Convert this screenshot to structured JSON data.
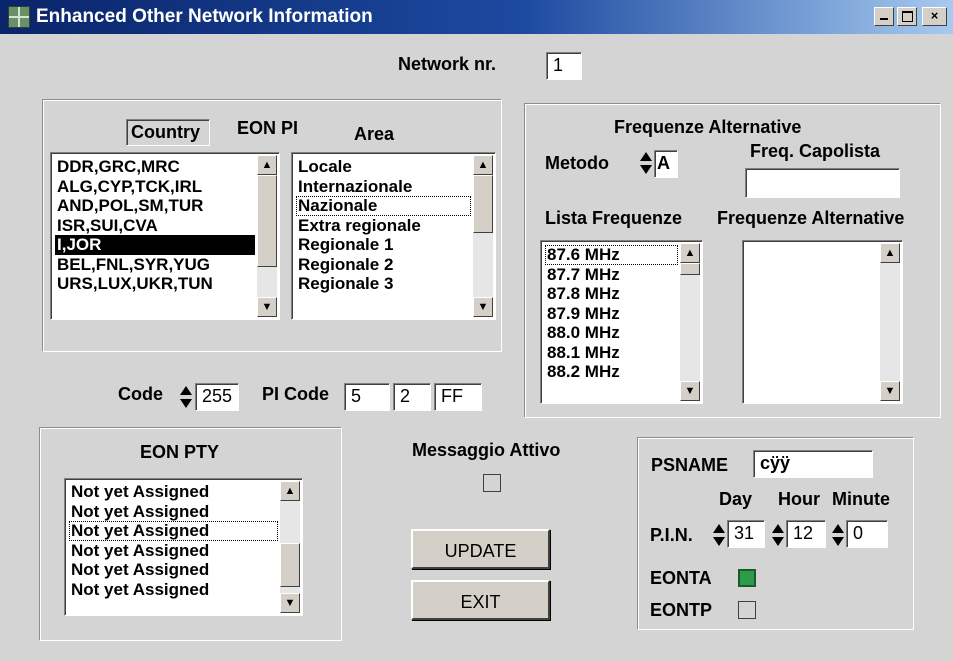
{
  "window": {
    "title": "Enhanced Other Network Information",
    "minimize": "_",
    "maximize": "□",
    "close": "×"
  },
  "network": {
    "label": "Network nr.",
    "value": "1"
  },
  "eon_pi": {
    "country_header": "Country",
    "group_title": "EON PI",
    "area_header": "Area",
    "countries": [
      "DDR,GRC,MRC",
      "ALG,CYP,TCK,IRL",
      "AND,POL,SM,TUR",
      "ISR,SUI,CVA",
      "I,JOR",
      "BEL,FNL,SYR,YUG",
      "URS,LUX,UKR,TUN"
    ],
    "countries_selected_index": 4,
    "areas": [
      "Locale",
      "Internazionale",
      "Nazionale",
      "Extra regionale",
      "Regionale 1",
      "Regionale 2",
      "Regionale 3"
    ],
    "areas_focused_index": 2
  },
  "code": {
    "label": "Code",
    "value": "255"
  },
  "pi_code": {
    "label": "PI Code",
    "values": [
      "5",
      "2",
      "FF"
    ]
  },
  "freq": {
    "group_title": "Frequenze Alternative",
    "metodo_label": "Metodo",
    "metodo_value": "A",
    "capolista_label": "Freq. Capolista",
    "capolista_value": "",
    "lista_label": "Lista Frequenze",
    "alt_label": "Frequenze Alternative",
    "lista": [
      "87.6 MHz",
      "87.7 MHz",
      "87.8 MHz",
      "87.9 MHz",
      "88.0 MHz",
      "88.1 MHz",
      "88.2 MHz"
    ],
    "alternative": []
  },
  "eon_pty": {
    "title": "EON PTY",
    "items": [
      "Not yet Assigned",
      "Not yet Assigned",
      "Not yet Assigned",
      "Not yet Assigned",
      "Not yet Assigned",
      "Not yet Assigned"
    ],
    "focused_index": 2
  },
  "messaggio": {
    "label": "Messaggio Attivo",
    "checked": false
  },
  "buttons": {
    "update": "UPDATE",
    "exit": "EXIT"
  },
  "ps": {
    "psname_label": "PSNAME",
    "psname_value": "cÿÿ",
    "day_label": "Day",
    "hour_label": "Hour",
    "minute_label": "Minute",
    "pin_label": "P.I.N.",
    "day": "31",
    "hour": "12",
    "minute": "0",
    "eonta_label": "EONTA",
    "eonta_checked": true,
    "eontp_label": "EONTP",
    "eontp_checked": false,
    "checked_color": "#2e9b4a"
  }
}
